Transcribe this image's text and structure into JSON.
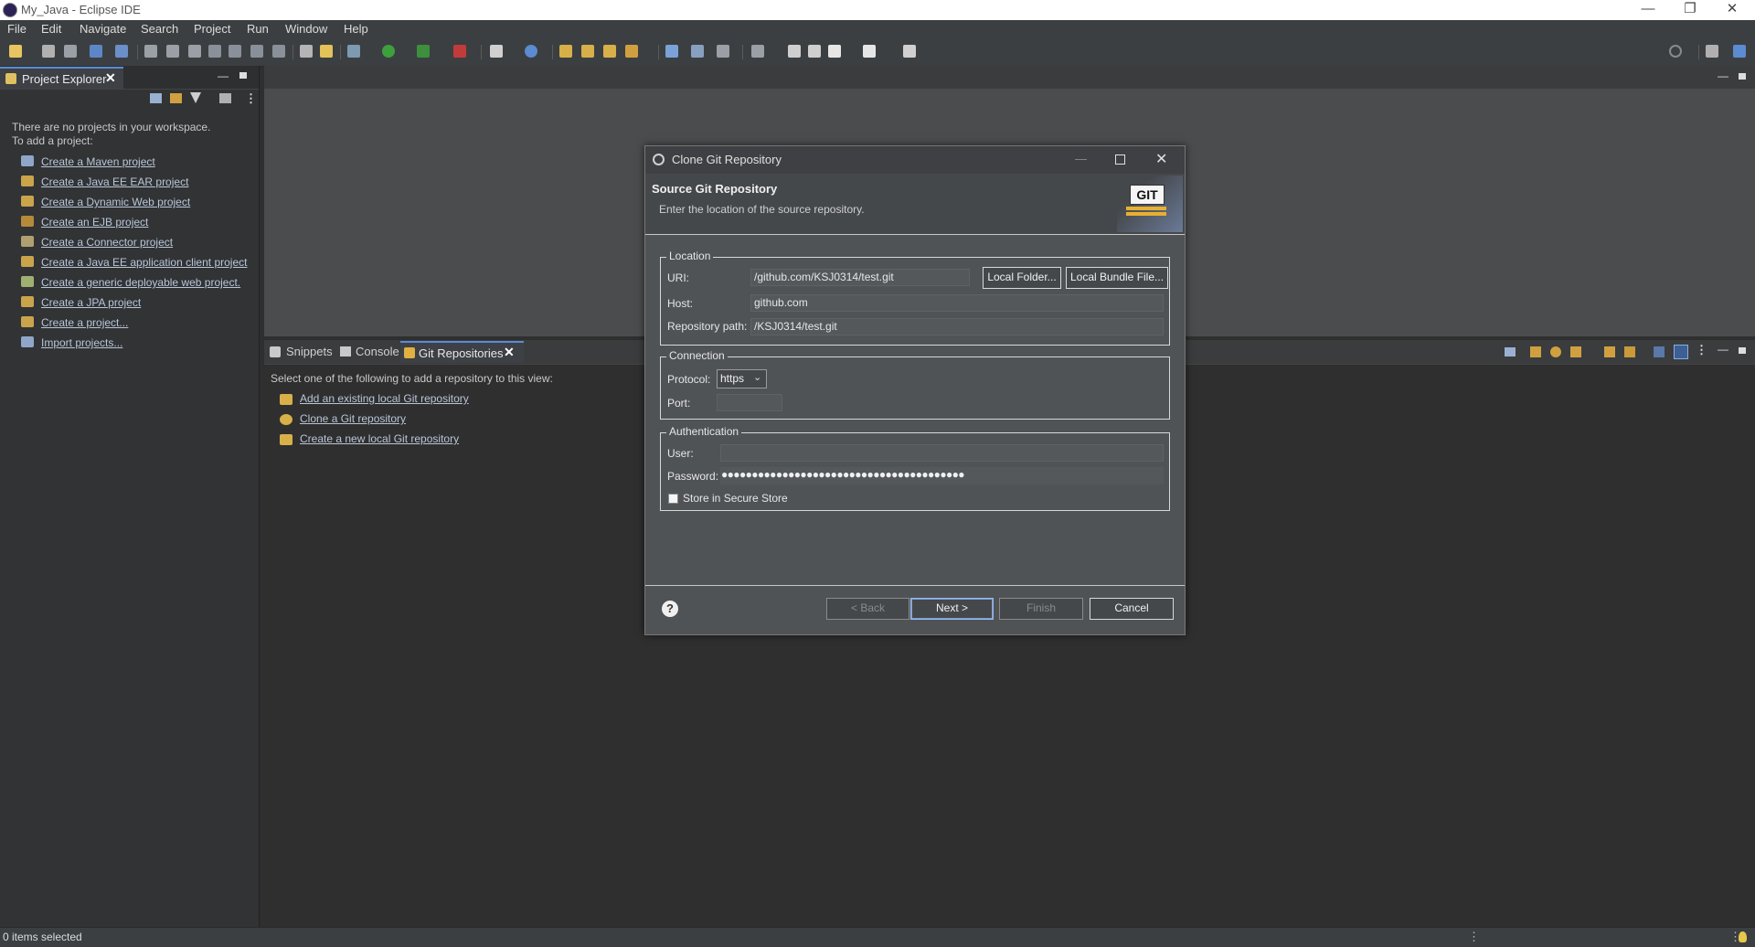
{
  "window": {
    "title": "My_Java - Eclipse IDE"
  },
  "menu": [
    "File",
    "Edit",
    "Navigate",
    "Search",
    "Project",
    "Run",
    "Window",
    "Help"
  ],
  "project_explorer": {
    "tab_label": "Project Explorer",
    "empty_line1": "There are no projects in your workspace.",
    "empty_line2": "To add a project:",
    "links": [
      "Create a Maven project",
      "Create a Java EE EAR project",
      "Create a Dynamic Web project",
      "Create an EJB project",
      "Create a Connector project",
      "Create a Java EE application client project",
      "Create a generic deployable web project.",
      "Create a JPA project",
      "Create a project...",
      "Import projects..."
    ]
  },
  "bottom_view": {
    "tabs": [
      "Snippets",
      "Console",
      "Git Repositories"
    ],
    "active_tab": "Git Repositories",
    "intro": "Select one of the following to add a repository to this view:",
    "links": [
      "Add an existing local Git repository",
      "Clone a Git repository",
      "Create a new local Git repository"
    ]
  },
  "status": {
    "text": "0 items selected"
  },
  "dialog": {
    "title": "Clone Git Repository",
    "header_title": "Source Git Repository",
    "header_subtitle": "Enter the location of the source repository.",
    "logo_text": "GIT",
    "location": {
      "group_label": "Location",
      "uri_label": "URI:",
      "uri_value": "/github.com/KSJ0314/test.git",
      "local_folder_btn": "Local Folder...",
      "local_bundle_btn": "Local Bundle File...",
      "host_label": "Host:",
      "host_value": "github.com",
      "repo_path_label": "Repository path:",
      "repo_path_value": "/KSJ0314/test.git"
    },
    "connection": {
      "group_label": "Connection",
      "protocol_label": "Protocol:",
      "protocol_value": "https",
      "port_label": "Port:",
      "port_value": ""
    },
    "authentication": {
      "group_label": "Authentication",
      "user_label": "User:",
      "user_value": "",
      "password_label": "Password:",
      "password_mask": "●●●●●●●●●●●●●●●●●●●●●●●●●●●●●●●●●●●●●●●●",
      "store_label": "Store in Secure Store",
      "store_checked": false
    },
    "buttons": {
      "back": "< Back",
      "next": "Next >",
      "finish": "Finish",
      "cancel": "Cancel"
    },
    "help_symbol": "?"
  }
}
